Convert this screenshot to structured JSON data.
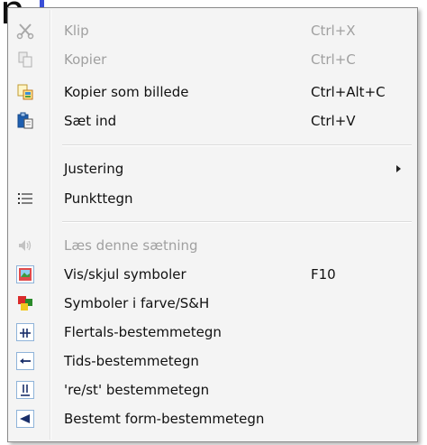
{
  "background": {
    "fragment_text": "n"
  },
  "menu": {
    "items": [
      {
        "label": "Klip",
        "shortcut": "Ctrl+X",
        "enabled": false,
        "icon": "scissors-icon"
      },
      {
        "label": "Kopier",
        "shortcut": "Ctrl+C",
        "enabled": false,
        "icon": "copy-icon"
      },
      {
        "label": "Kopier som billede",
        "shortcut": "Ctrl+Alt+C",
        "enabled": true,
        "icon": "copy-as-image-icon"
      },
      {
        "label": "Sæt ind",
        "shortcut": "Ctrl+V",
        "enabled": true,
        "icon": "paste-icon"
      },
      {
        "label": "Justering",
        "shortcut": "",
        "enabled": true,
        "icon": "",
        "submenu": true
      },
      {
        "label": "Punkttegn",
        "shortcut": "",
        "enabled": true,
        "icon": "bullet-list-icon"
      },
      {
        "label": "Læs denne sætning",
        "shortcut": "",
        "enabled": false,
        "icon": "speaker-icon"
      },
      {
        "label": "Vis/skjul symboler",
        "shortcut": "F10",
        "enabled": true,
        "icon": "symbols-picture-icon"
      },
      {
        "label": "Symboler i farve/S&H",
        "shortcut": "",
        "enabled": true,
        "icon": "color-symbols-icon"
      },
      {
        "label": "Flertals-bestemmetegn",
        "shortcut": "",
        "enabled": true,
        "icon": "plural-marker-icon"
      },
      {
        "label": "Tids-bestemmetegn",
        "shortcut": "",
        "enabled": true,
        "icon": "tense-marker-icon"
      },
      {
        "label": "'re/st' bestemmetegn",
        "shortcut": "",
        "enabled": true,
        "icon": "re-st-marker-icon"
      },
      {
        "label": "Bestemt form-bestemmetegn",
        "shortcut": "",
        "enabled": true,
        "icon": "definite-form-marker-icon"
      }
    ]
  },
  "colors": {
    "menu_background": "#f4f4f4",
    "disabled_text": "#a0a0a0",
    "text": "#111111",
    "icon_frame": "#8fb3d9",
    "caret": "#3a4fd8"
  }
}
